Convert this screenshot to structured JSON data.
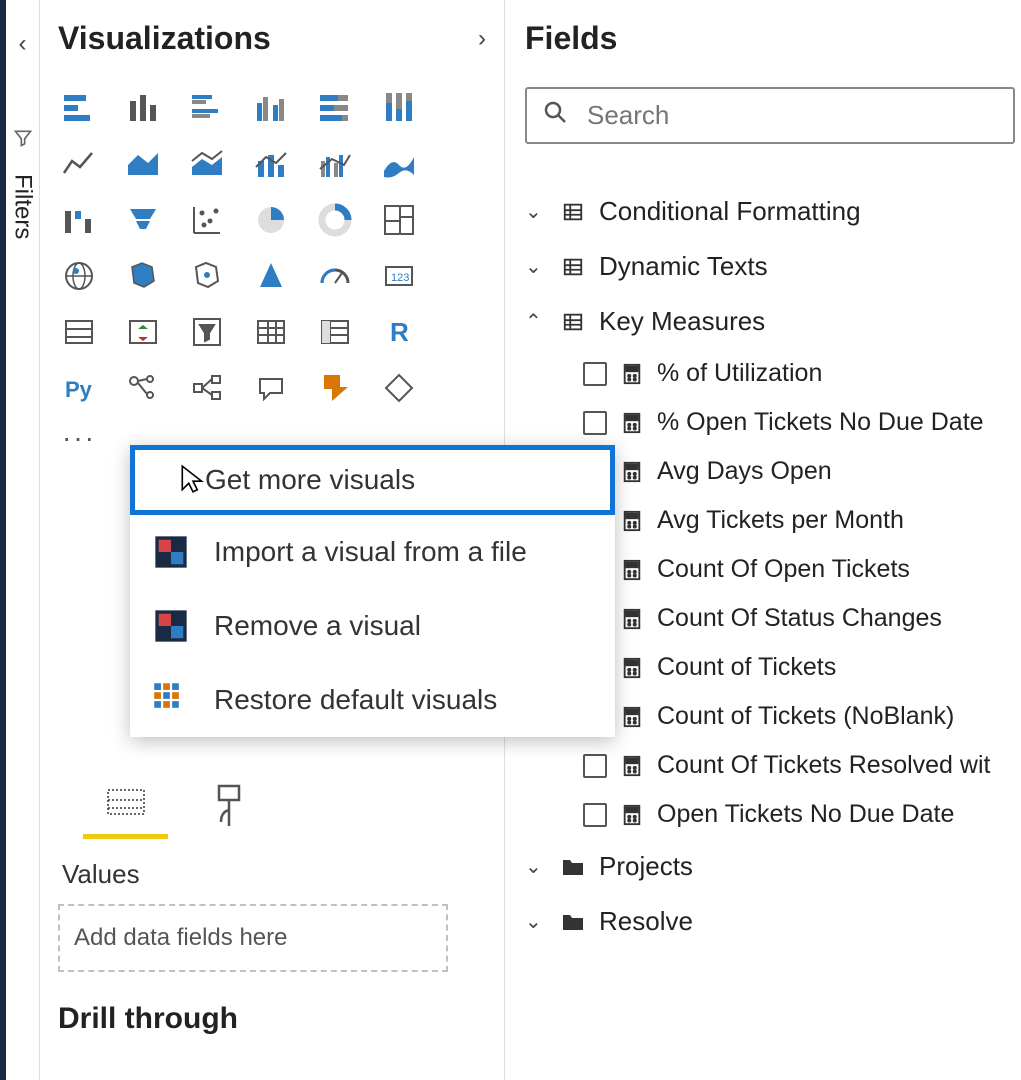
{
  "leftRail": {
    "filtersLabel": "Filters"
  },
  "vizPane": {
    "title": "Visualizations",
    "ellipsis": "···",
    "contextMenu": {
      "items": [
        {
          "label": "Get more visuals",
          "highlight": true
        },
        {
          "label": "Import a visual from a file"
        },
        {
          "label": "Remove a visual"
        },
        {
          "label": "Restore default visuals"
        }
      ]
    },
    "valuesLabel": "Values",
    "dropZonePlaceholder": "Add data fields here",
    "drillLabel": "Drill through"
  },
  "fieldsPane": {
    "title": "Fields",
    "searchPlaceholder": "Search",
    "tables": [
      {
        "name": "Conditional Formatting",
        "expanded": false,
        "icon": "table"
      },
      {
        "name": "Dynamic Texts",
        "expanded": false,
        "icon": "table"
      },
      {
        "name": "Key Measures",
        "expanded": true,
        "icon": "table",
        "measures": [
          "% of Utilization",
          "% Open Tickets No Due Date",
          "Avg Days Open",
          "Avg Tickets per Month",
          "Count Of Open Tickets",
          "Count Of Status Changes",
          "Count of Tickets",
          "Count of Tickets (NoBlank)",
          "Count Of Tickets Resolved wit",
          "Open Tickets No Due Date"
        ]
      },
      {
        "name": "Projects",
        "expanded": false,
        "icon": "folder"
      },
      {
        "name": "Resolve",
        "expanded": false,
        "icon": "folder"
      }
    ]
  },
  "icons": {
    "stackedBarH": "stacked-bar-horizontal-icon",
    "stackedBar": "stacked-bar-icon",
    "clusteredBarH": "clustered-bar-horizontal-icon",
    "clusteredBar": "clustered-bar-icon",
    "hundredBarH": "100-stacked-bar-horizontal-icon",
    "hundredBar": "100-stacked-bar-icon",
    "line": "line-chart-icon",
    "area": "area-chart-icon",
    "stackedArea": "stacked-area-chart-icon",
    "lineStacked": "line-stacked-column-icon",
    "lineClustered": "line-clustered-column-icon",
    "ribbon": "ribbon-chart-icon",
    "waterfall": "waterfall-icon",
    "funnel": "funnel-icon",
    "scatter": "scatter-icon",
    "pie": "pie-icon",
    "donut": "donut-icon",
    "treemap": "treemap-icon",
    "map": "map-icon",
    "filledMap": "filled-map-icon",
    "shapeMap": "shape-map-icon",
    "arcgis": "arcgis-icon",
    "gauge": "gauge-icon",
    "card": "card-icon",
    "multiCard": "multi-card-icon",
    "kpi": "kpi-icon",
    "slicer": "slicer-icon",
    "table": "table-icon",
    "matrix": "matrix-icon",
    "r": "r-visual-icon",
    "py": "python-visual-icon",
    "keyInfluencers": "key-influencers-icon",
    "decomposition": "decomposition-tree-icon",
    "qna": "qna-icon",
    "powerApps": "power-apps-icon",
    "diamond": "custom-visual-icon"
  }
}
